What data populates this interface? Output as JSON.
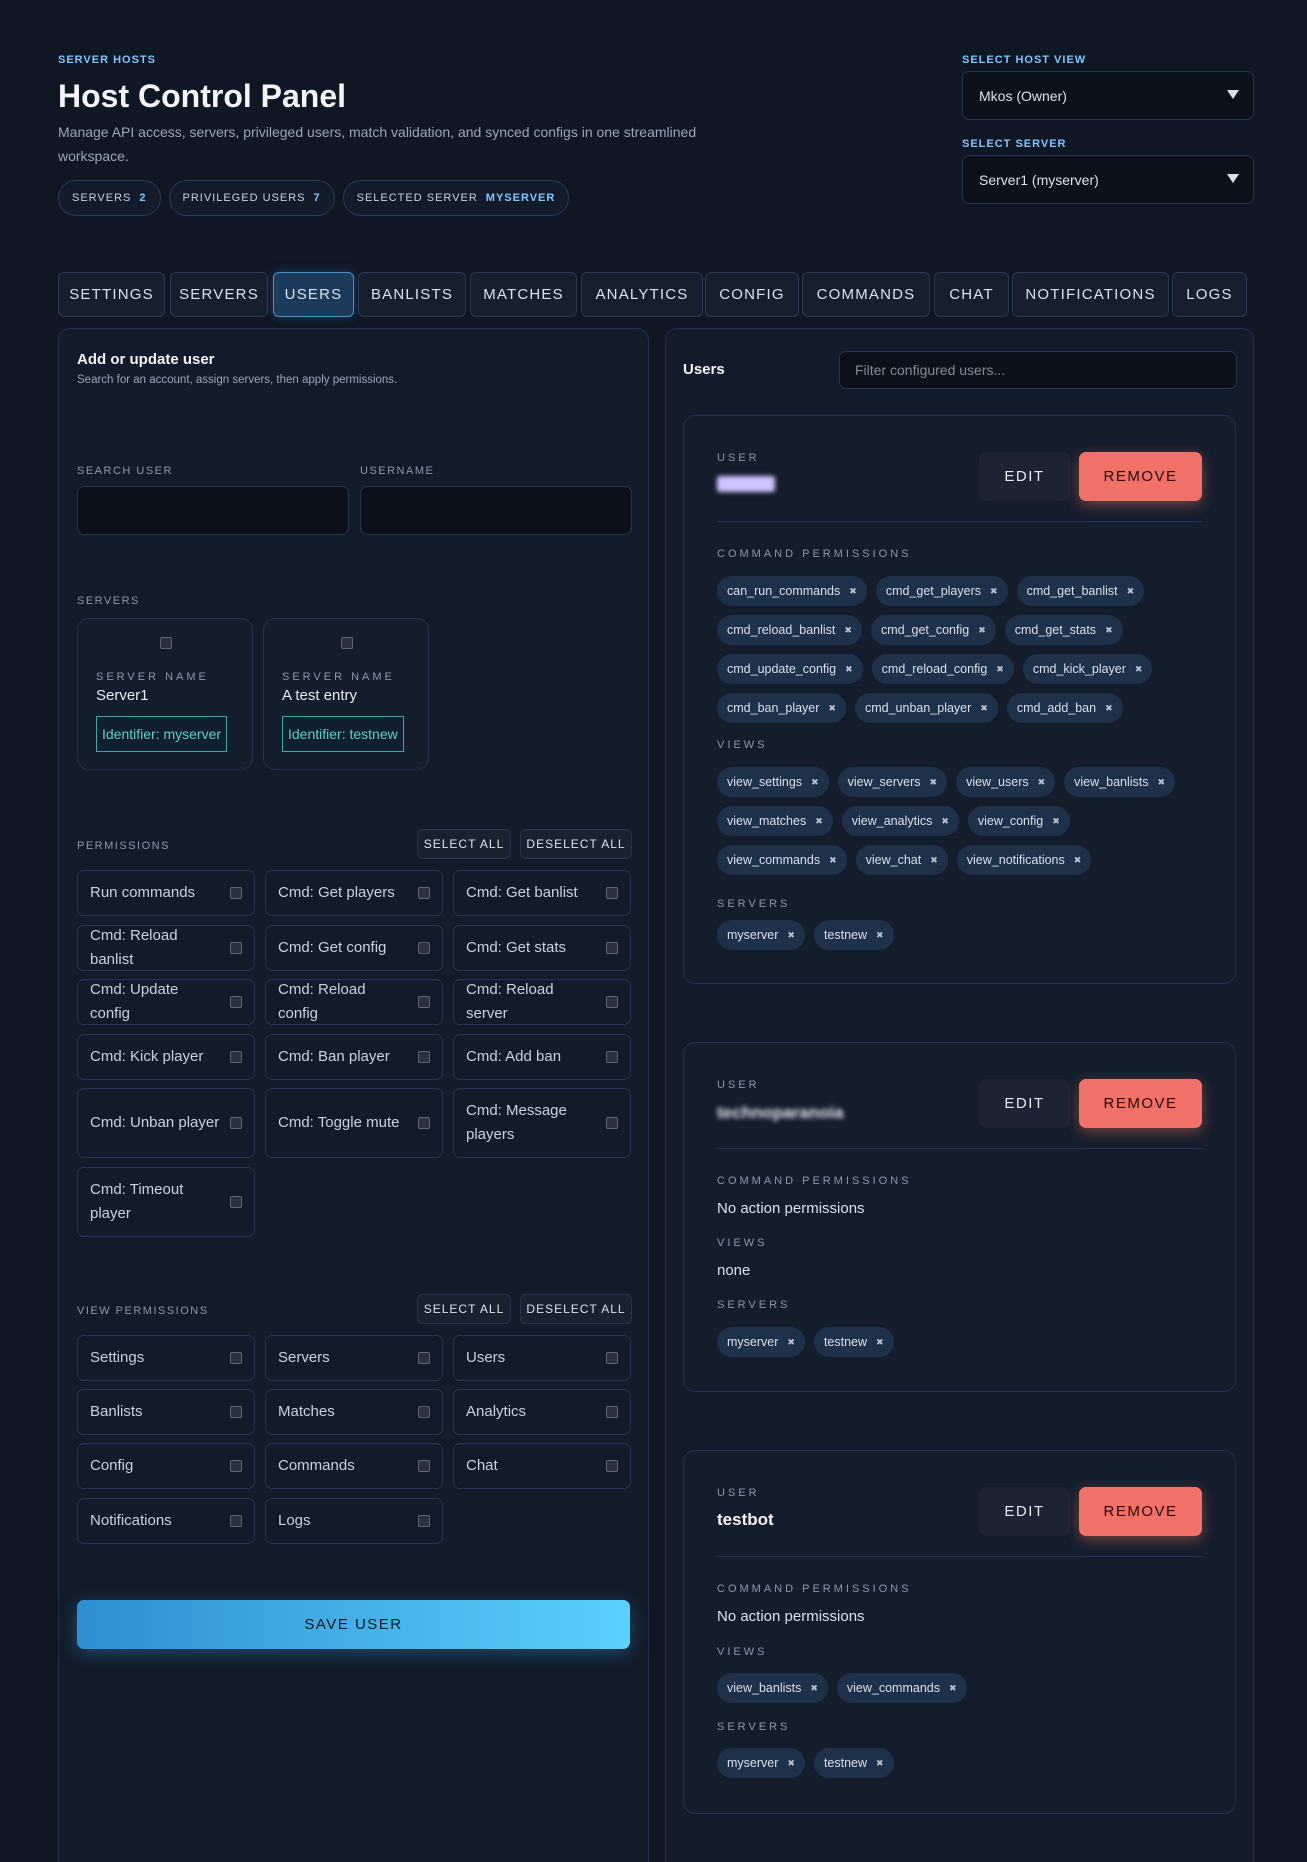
{
  "header": {
    "eyebrow": "SERVER HOSTS",
    "title": "Host Control Panel",
    "description": "Manage API access, servers, privileged users, match validation, and synced configs in one streamlined workspace.",
    "stats": [
      {
        "label": "SERVERS",
        "value": "2"
      },
      {
        "label": "PRIVILEGED USERS",
        "value": "7"
      },
      {
        "label": "SELECTED SERVER",
        "value": "MYSERVER"
      }
    ]
  },
  "host_view": {
    "label": "SELECT HOST VIEW",
    "value": "Mkos (Owner)"
  },
  "server_select": {
    "label": "SELECT SERVER",
    "value": "Server1 (myserver)"
  },
  "tabs": [
    "SETTINGS",
    "SERVERS",
    "USERS",
    "BANLISTS",
    "MATCHES",
    "ANALYTICS",
    "CONFIG",
    "COMMANDS",
    "CHAT",
    "NOTIFICATIONS",
    "LOGS"
  ],
  "active_tab": "USERS",
  "form": {
    "title": "Add or update user",
    "subtitle": "Search for an account, assign servers, then apply permissions.",
    "search_label": "SEARCH USER",
    "username_label": "USERNAME",
    "servers_label": "SERVERS",
    "servers": [
      {
        "caption": "SERVER NAME",
        "name": "Server1",
        "identifier": "Identifier: myserver"
      },
      {
        "caption": "SERVER NAME",
        "name": "A test entry",
        "identifier": "Identifier: testnew"
      }
    ],
    "permissions_label": "PERMISSIONS",
    "select_all": "SELECT ALL",
    "deselect_all": "DESELECT ALL",
    "permissions": [
      "Run commands",
      "Cmd: Get players",
      "Cmd: Get banlist",
      "Cmd: Reload banlist",
      "Cmd: Get config",
      "Cmd: Get stats",
      "Cmd: Update config",
      "Cmd: Reload config",
      "Cmd: Reload server",
      "Cmd: Kick player",
      "Cmd: Ban player",
      "Cmd: Add ban",
      "Cmd: Unban player",
      "Cmd: Toggle mute",
      "Cmd: Message players",
      "Cmd: Timeout player"
    ],
    "view_permissions_label": "VIEW PERMISSIONS",
    "view_permissions": [
      "Settings",
      "Servers",
      "Users",
      "Banlists",
      "Matches",
      "Analytics",
      "Config",
      "Commands",
      "Chat",
      "Notifications",
      "Logs"
    ],
    "save_label": "SAVE USER"
  },
  "users_panel": {
    "title": "Users",
    "filter_placeholder": "Filter configured users...",
    "user_caption": "USER",
    "edit_label": "EDIT",
    "remove_label": "REMOVE",
    "cmd_caption": "COMMAND PERMISSIONS",
    "views_caption": "VIEWS",
    "servers_caption": "SERVERS",
    "users": [
      {
        "name": "redacted",
        "commands": [
          "can_run_commands",
          "cmd_get_players",
          "cmd_get_banlist",
          "cmd_reload_banlist",
          "cmd_get_config",
          "cmd_get_stats",
          "cmd_update_config",
          "cmd_reload_config",
          "cmd_kick_player",
          "cmd_ban_player",
          "cmd_unban_player",
          "cmd_add_ban"
        ],
        "views": [
          "view_settings",
          "view_servers",
          "view_users",
          "view_banlists",
          "view_matches",
          "view_analytics",
          "view_config",
          "view_commands",
          "view_chat",
          "view_notifications"
        ],
        "servers": [
          "myserver",
          "testnew"
        ]
      },
      {
        "name": "technoparanoia",
        "commands_text": "No action permissions",
        "views_text": "none",
        "servers": [
          "myserver",
          "testnew"
        ]
      },
      {
        "name": "testbot",
        "commands_text": "No action permissions",
        "views": [
          "view_banlists",
          "view_commands"
        ],
        "servers": [
          "myserver",
          "testnew"
        ]
      }
    ]
  },
  "colors": {
    "accent": "#7fc6ff",
    "danger": "#f07168",
    "save_gradient_start": "#2d8fd0",
    "save_gradient_end": "#5ad0fb"
  }
}
